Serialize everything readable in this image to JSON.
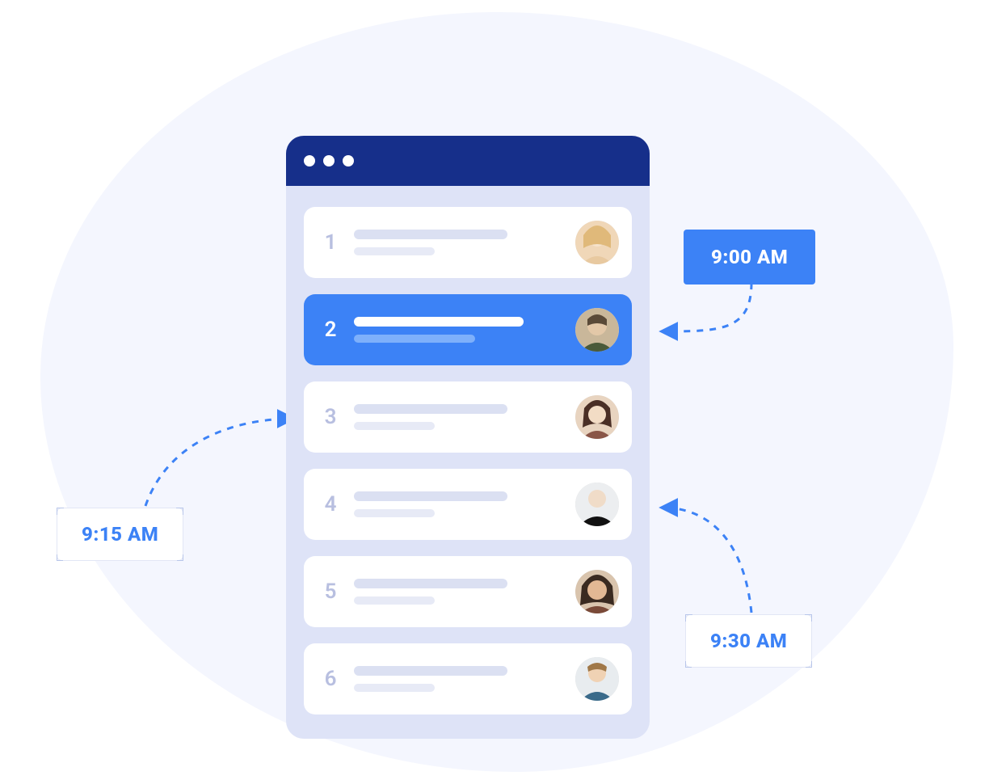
{
  "list": {
    "items": [
      {
        "num": "1",
        "active": false,
        "avatar": "f1"
      },
      {
        "num": "2",
        "active": true,
        "avatar": "m1"
      },
      {
        "num": "3",
        "active": false,
        "avatar": "f2"
      },
      {
        "num": "4",
        "active": false,
        "avatar": "m2"
      },
      {
        "num": "5",
        "active": false,
        "avatar": "f3"
      },
      {
        "num": "6",
        "active": false,
        "avatar": "m3"
      }
    ]
  },
  "badges": [
    {
      "label": "9:00 AM",
      "style": "filled",
      "points_to_item": 2
    },
    {
      "label": "9:15 AM",
      "style": "outline",
      "points_to_item": 3
    },
    {
      "label": "9:30 AM",
      "style": "outline",
      "points_to_item": 4
    }
  ],
  "colors": {
    "accent": "#3c82f6",
    "titlebar": "#162f8a",
    "window_bg": "#dee3f7",
    "blob": "#f4f6fe"
  }
}
